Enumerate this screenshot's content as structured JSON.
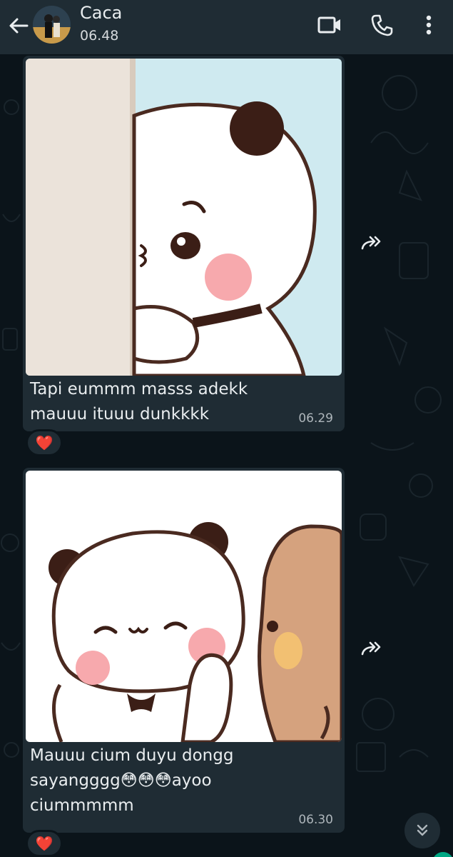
{
  "header": {
    "contact_name": "Caca",
    "status": "06.48",
    "icons": [
      "back-arrow-icon",
      "video-call-icon",
      "phone-icon",
      "more-options-icon"
    ]
  },
  "messages": [
    {
      "type": "sticker-with-caption",
      "sticker": "panda peeking from behind wall sticker",
      "caption": "Tapi eummm masss adekk mauuu ituuu dunkkkk",
      "time": "06.29",
      "reaction": "❤️"
    },
    {
      "type": "sticker-with-caption",
      "sticker": "panda blushing next to brown bear sticker",
      "caption": "Mauuu cium duyu dongg sayangggg😳😳😳ayoo ciummmmm",
      "time": "06.30",
      "reaction": "❤️"
    }
  ],
  "colors": {
    "background": "#0b141a",
    "header": "#1f2c34",
    "bubble": "#1f2c34",
    "accent": "#00a884",
    "time_text": "#aeb6bb"
  }
}
